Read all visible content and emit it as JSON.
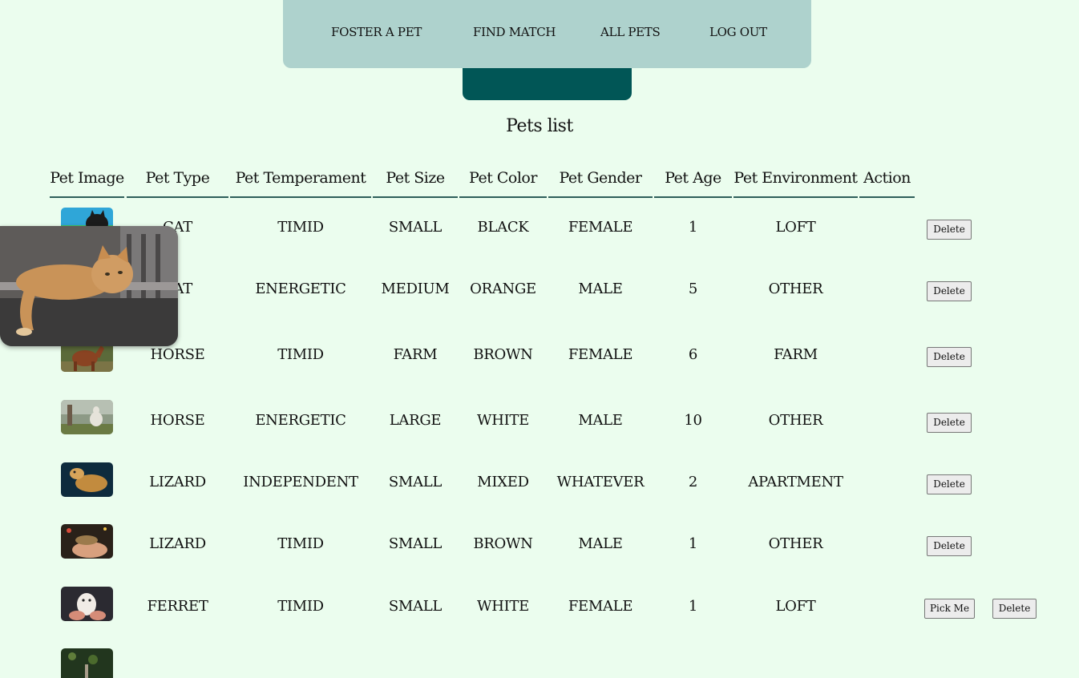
{
  "nav": {
    "items": [
      "FOSTER A PET",
      "FIND MATCH",
      "ALL PETS",
      "LOG OUT"
    ]
  },
  "page_title": "Pets list",
  "table": {
    "headers": [
      "Pet Image",
      "Pet Type",
      "Pet Temperament",
      "Pet Size",
      "Pet Color",
      "Pet Gender",
      "Pet Age",
      "Pet Environment",
      "Action"
    ],
    "rows": [
      {
        "type": "CAT",
        "temperament": "TIMID",
        "size": "SMALL",
        "color": "BLACK",
        "gender": "FEMALE",
        "age": "1",
        "environment": "LOFT",
        "image": "black-cat-photo"
      },
      {
        "type": "CAT",
        "temperament": "ENERGETIC",
        "size": "MEDIUM",
        "color": "ORANGE",
        "gender": "MALE",
        "age": "5",
        "environment": "OTHER",
        "image": "orange-cat-photo"
      },
      {
        "type": "HORSE",
        "temperament": "TIMID",
        "size": "FARM",
        "color": "BROWN",
        "gender": "FEMALE",
        "age": "6",
        "environment": "FARM",
        "image": "brown-horse-photo"
      },
      {
        "type": "HORSE",
        "temperament": "ENERGETIC",
        "size": "LARGE",
        "color": "WHITE",
        "gender": "MALE",
        "age": "10",
        "environment": "OTHER",
        "image": "white-horse-photo"
      },
      {
        "type": "LIZARD",
        "temperament": "INDEPENDENT",
        "size": "SMALL",
        "color": "MIXED",
        "gender": "WHATEVER",
        "age": "2",
        "environment": "APARTMENT",
        "image": "bearded-dragon-photo"
      },
      {
        "type": "LIZARD",
        "temperament": "TIMID",
        "size": "SMALL",
        "color": "BROWN",
        "gender": "MALE",
        "age": "1",
        "environment": "OTHER",
        "image": "lizard-in-hand-photo"
      },
      {
        "type": "FERRET",
        "temperament": "TIMID",
        "size": "SMALL",
        "color": "WHITE",
        "gender": "FEMALE",
        "age": "1",
        "environment": "LOFT",
        "image": "white-ferret-photo"
      },
      {
        "image": "partial-pet-photo"
      }
    ],
    "delete_label": "Delete",
    "pick_label": "Pick Me"
  },
  "popup": {
    "image": "orange-cat-enlarged-photo"
  },
  "colors": {
    "background": "#ebfdee",
    "navbar": "#aed2cd",
    "accent": "#015656",
    "header_underline": "#2d5e5a"
  }
}
